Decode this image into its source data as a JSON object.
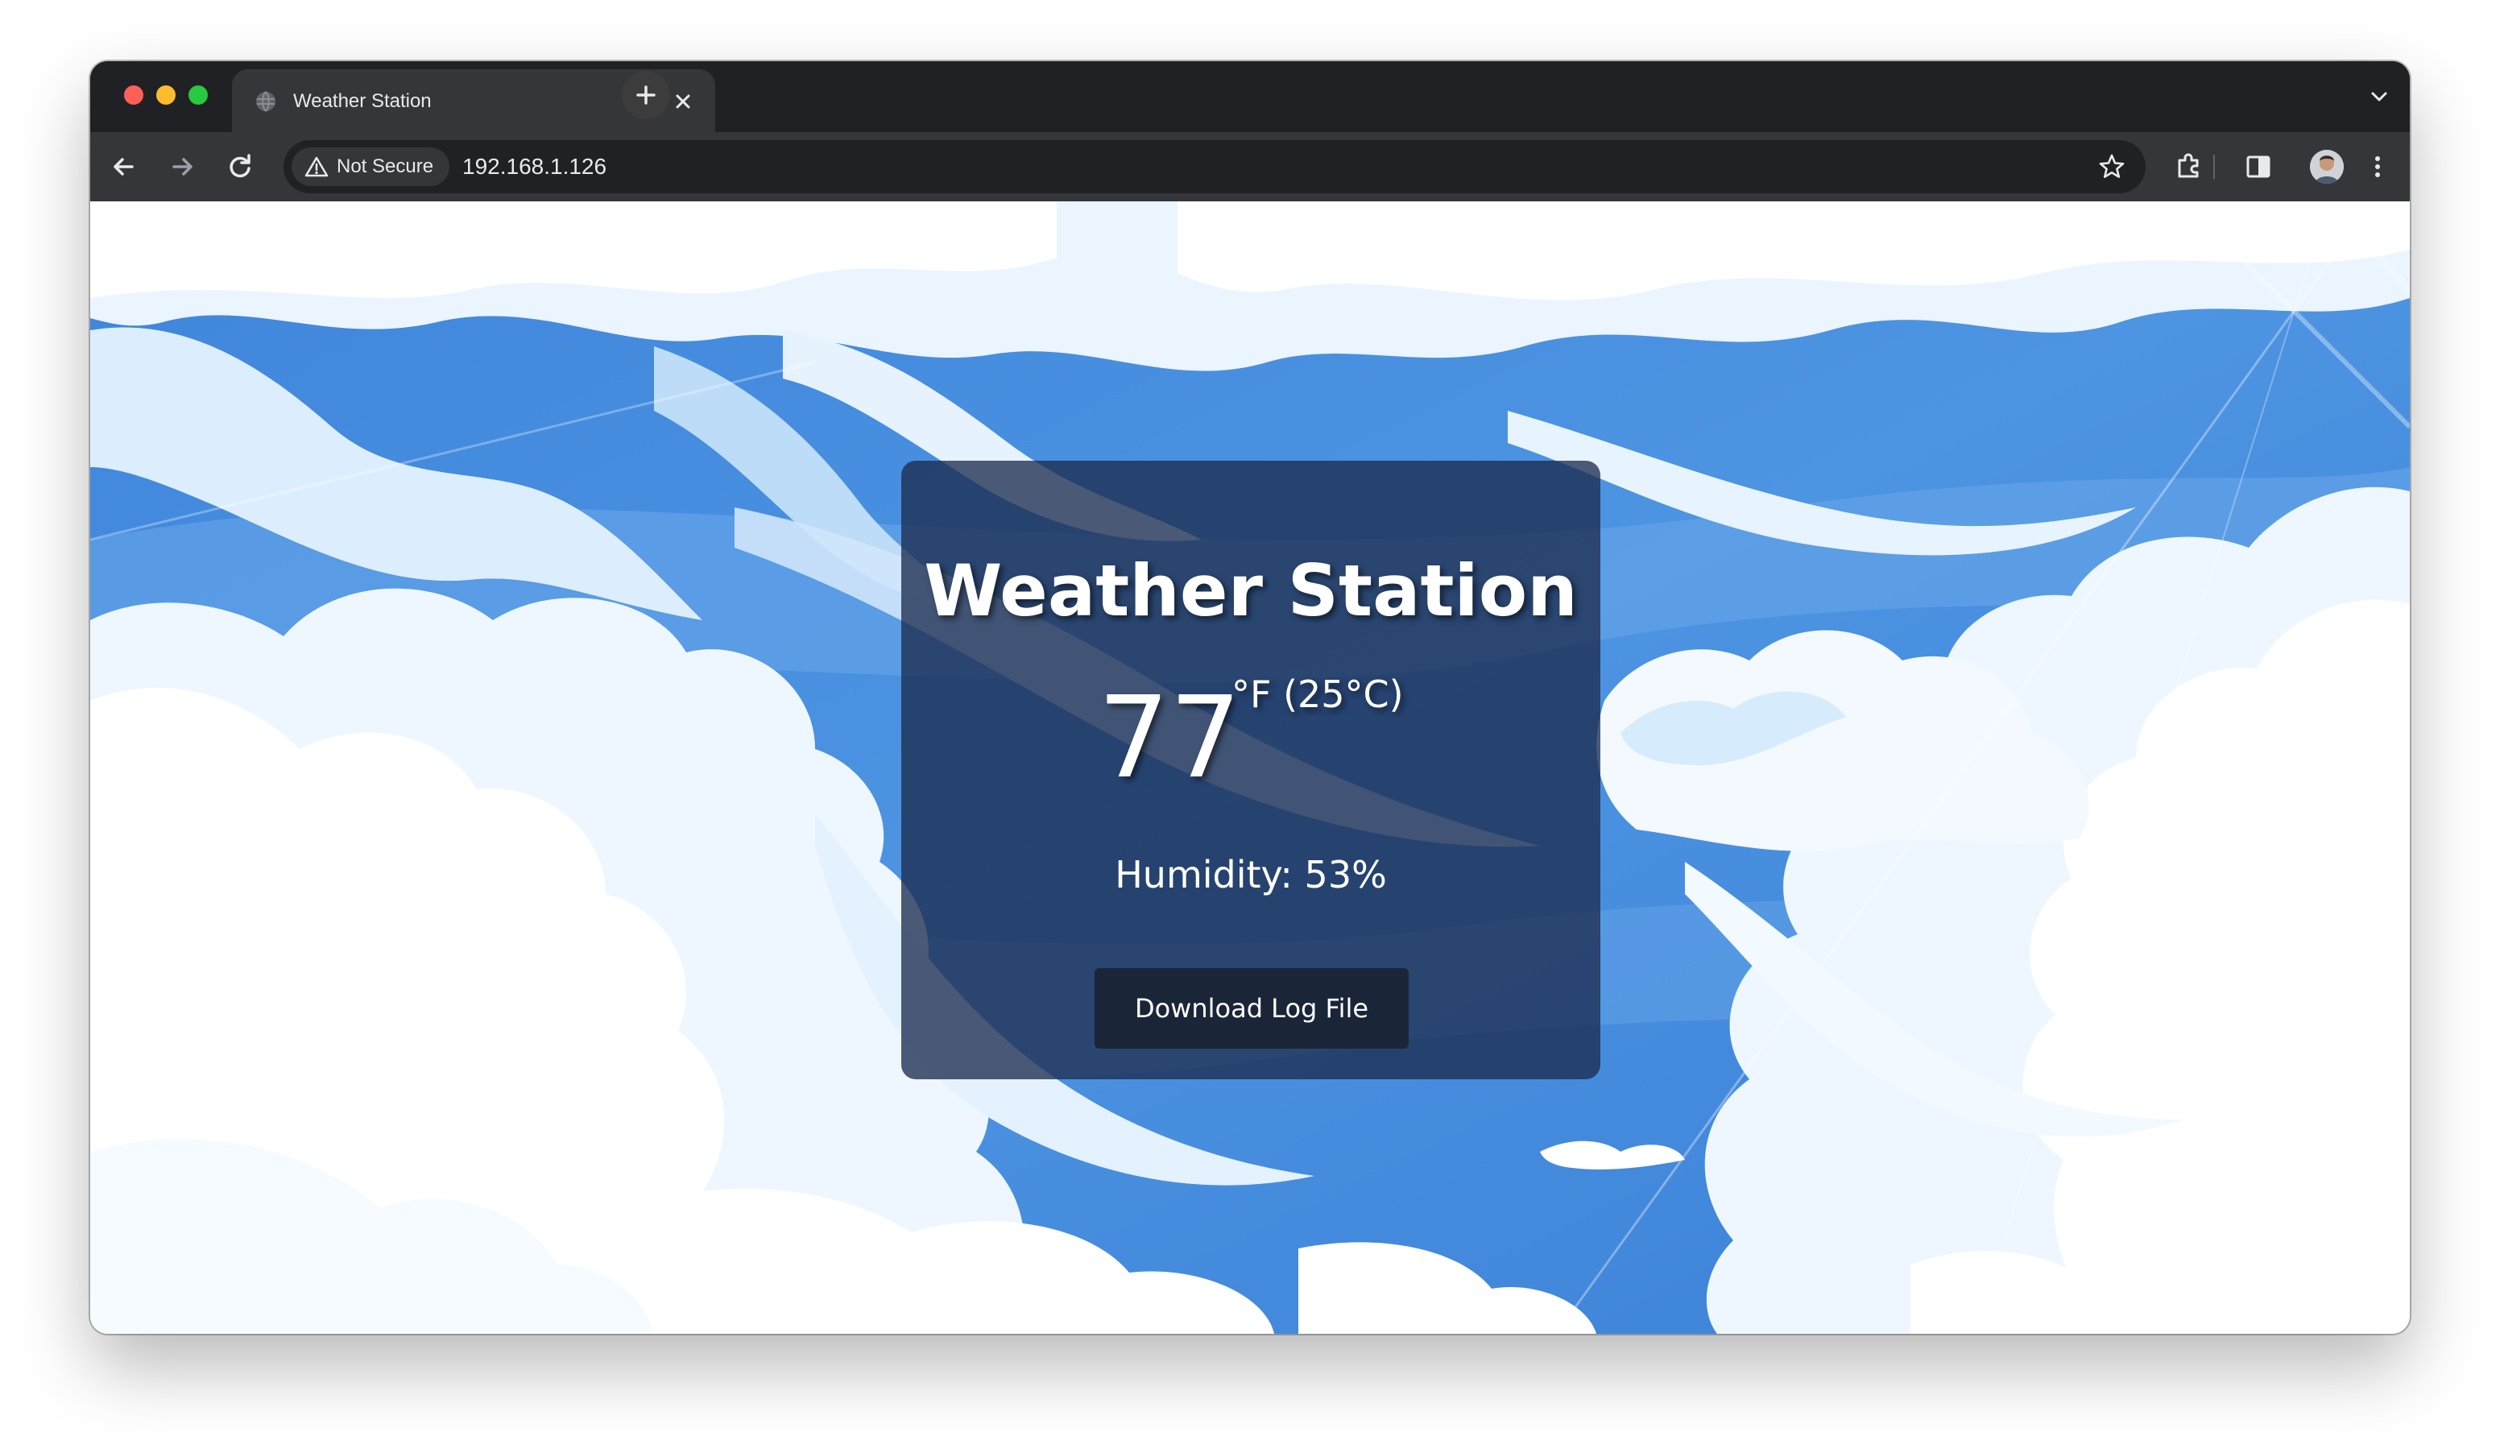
{
  "browser": {
    "tab": {
      "title": "Weather Station",
      "favicon": "globe-icon",
      "close_icon": "close-icon"
    },
    "new_tab_icon": "plus-icon",
    "tab_menu_icon": "chevron-down-icon",
    "toolbar": {
      "back_icon": "arrow-left-icon",
      "forward_icon": "arrow-right-icon",
      "reload_icon": "reload-icon",
      "security_chip": "Not Secure",
      "security_icon": "warning-triangle-icon",
      "url": "192.168.1.126",
      "bookmark_icon": "star-icon",
      "extensions_icon": "puzzle-icon",
      "sidepanel_icon": "side-panel-icon",
      "profile_icon": "avatar",
      "menu_icon": "kebab-menu-icon"
    },
    "colors": {
      "traffic_red": "#fe5f57",
      "traffic_yellow": "#febc2e",
      "traffic_green": "#28c840",
      "tabstrip": "#202124",
      "toolbar": "#35363a"
    }
  },
  "page": {
    "title": "Weather Station",
    "temperature_value": "77",
    "temperature_unit": "°F (25°C)",
    "humidity": "Humidity: 53%",
    "download_button": "Download Log File",
    "colors": {
      "sky_blue": "#4a8fdc",
      "card_bg": "#1c2d50",
      "button_bg": "#1a2638"
    }
  }
}
